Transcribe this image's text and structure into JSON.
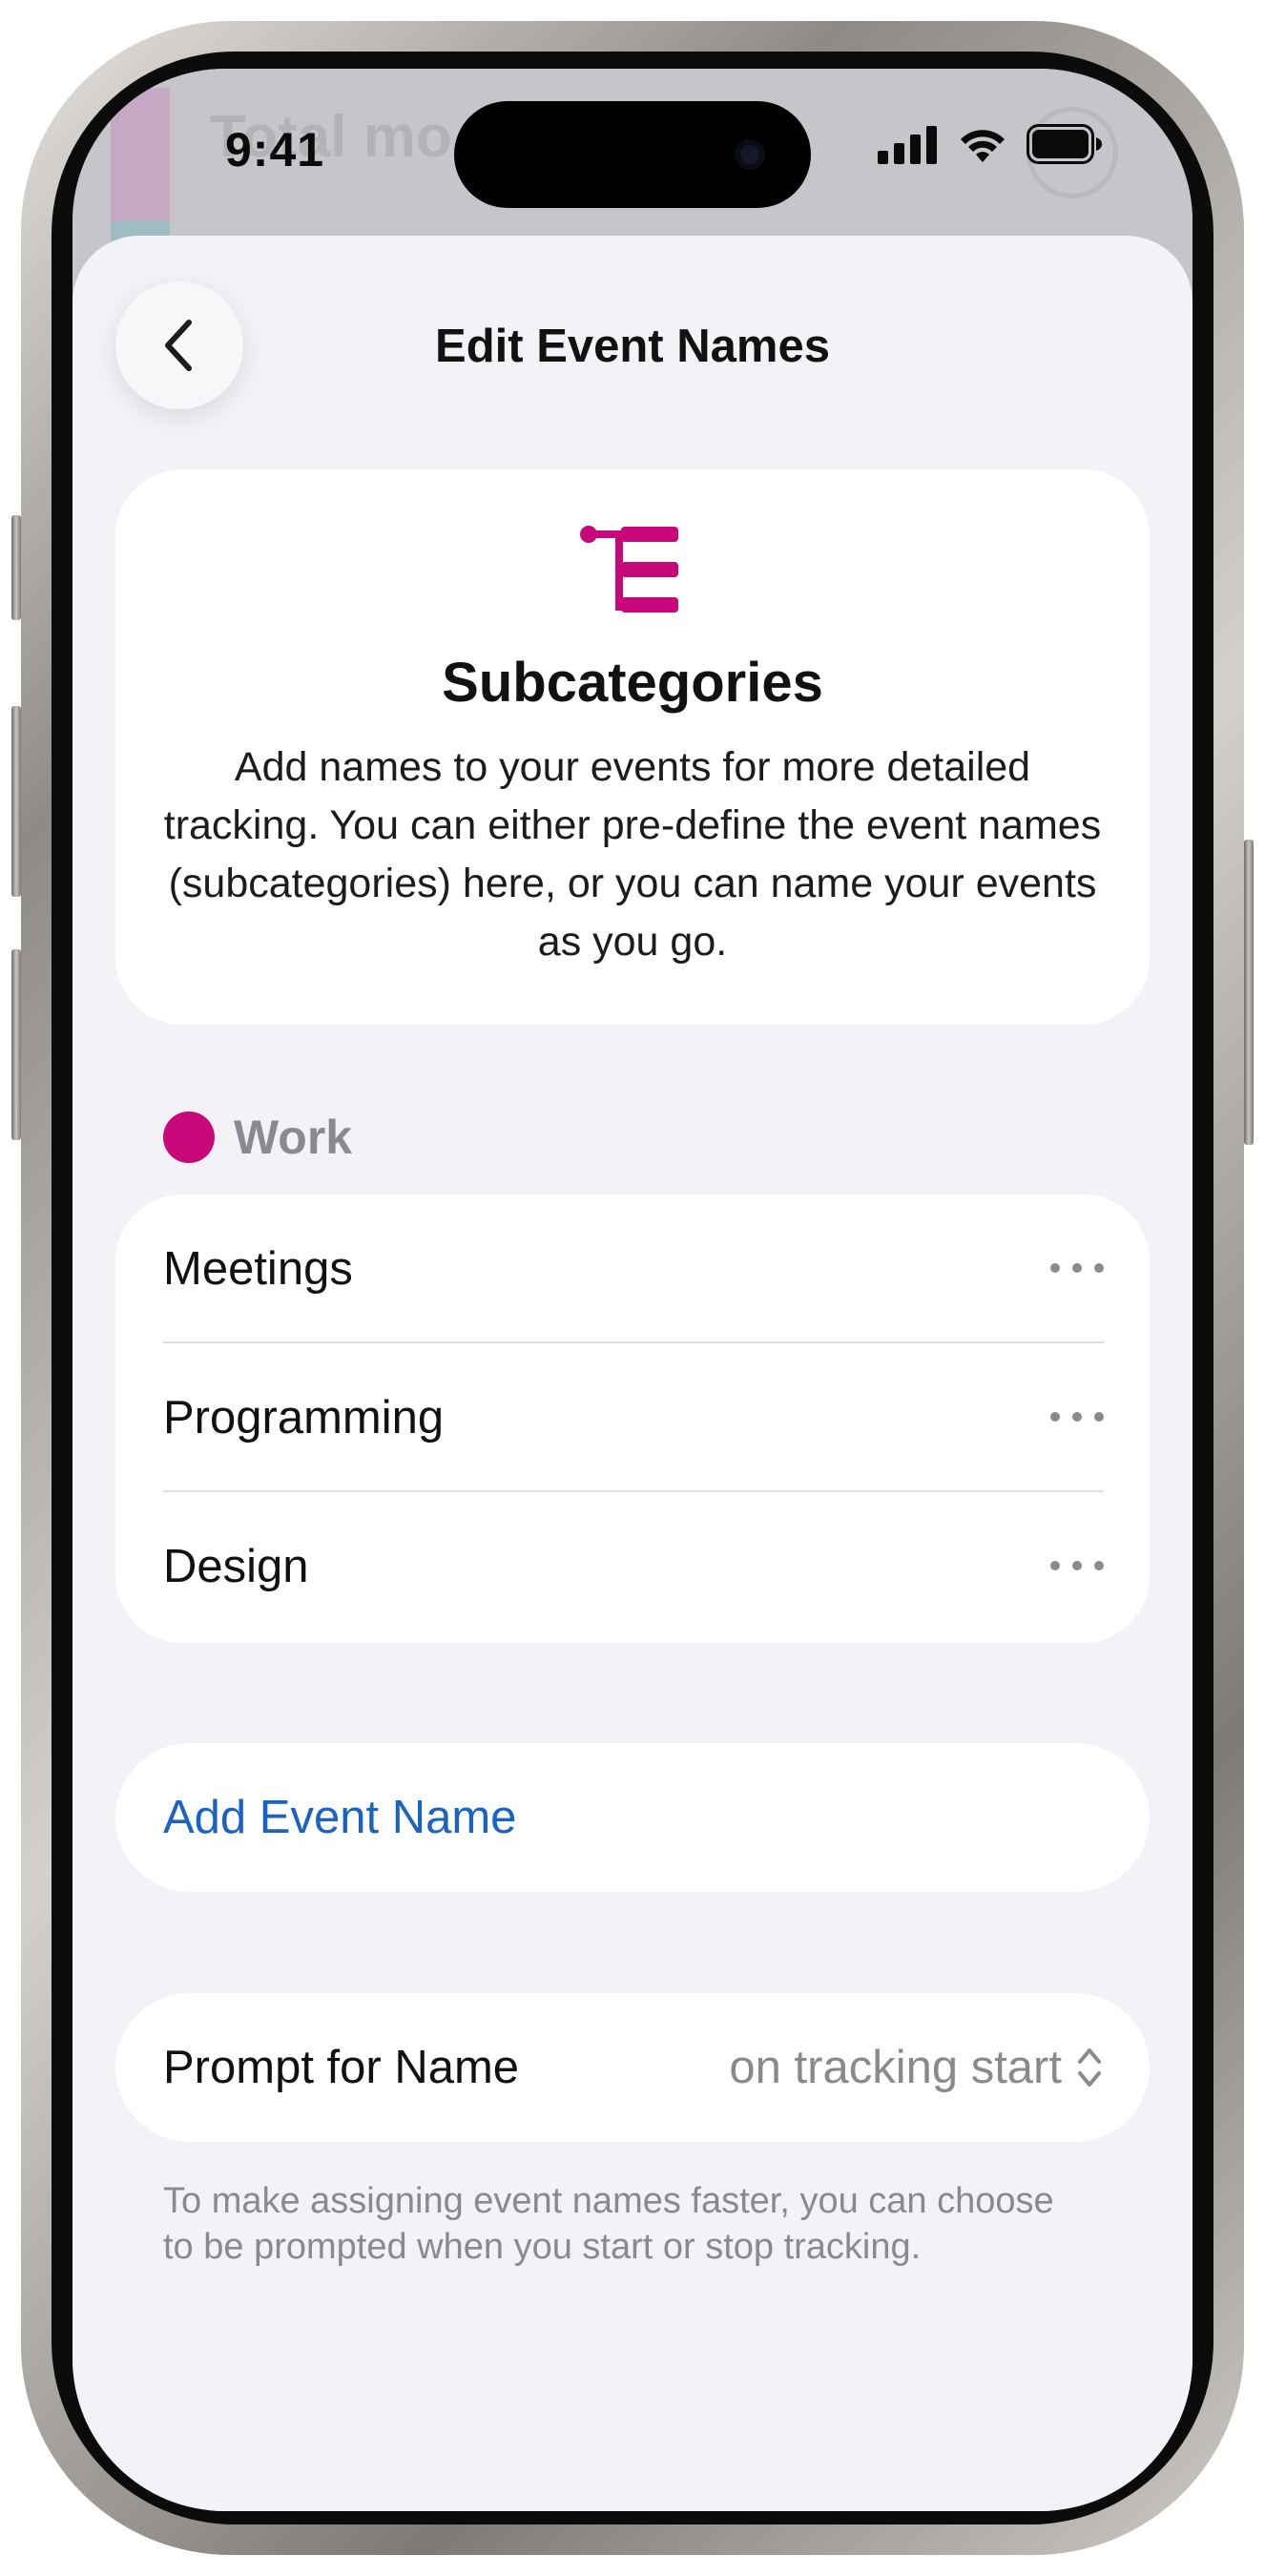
{
  "status_bar": {
    "time": "9:41",
    "background_peek_title": "Total mo"
  },
  "nav": {
    "title": "Edit Event Names",
    "back_icon": "chevron-left-icon"
  },
  "info_card": {
    "icon": "subcategories-tree-icon",
    "title": "Subcategories",
    "description": "Add names to your events for more detailed tracking. You can either pre-define the event names (subcategories) here, or you can name your events as you go."
  },
  "category": {
    "label": "Work",
    "color": "#c8087a"
  },
  "event_names": [
    {
      "label": "Meetings"
    },
    {
      "label": "Programming"
    },
    {
      "label": "Design"
    }
  ],
  "add_button": {
    "label": "Add Event Name",
    "color": "#1a63c3"
  },
  "prompt": {
    "label": "Prompt for Name",
    "value": "on tracking start",
    "icon": "chevron-up-down-icon"
  },
  "footnote": "To make assigning event names faster, you can choose to be prompted when you start or stop tracking.",
  "colors": {
    "accent": "#c8087a",
    "link": "#1a63c3",
    "sheet_background": "#f2f2f7"
  }
}
